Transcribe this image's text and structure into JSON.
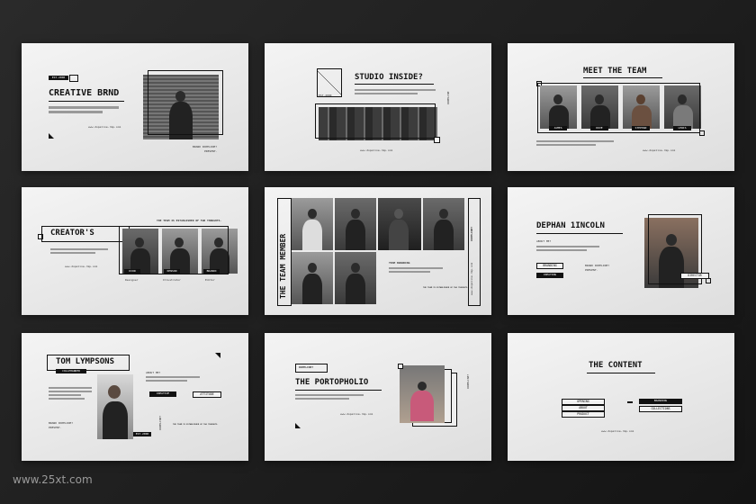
{
  "s1": {
    "badge": "EST.2000",
    "title": "CREATIVE BRND",
    "url": "www.dopeline-rmp.com",
    "footer1": "BRAND DOPELINE?",
    "footer2": "PRESENT."
  },
  "s2": {
    "title": "STUDIO INSIDE?",
    "label": "EST.2000",
    "side": "DOPELINE",
    "url": "www.dopeline-rmp.com"
  },
  "s3": {
    "title": "MEET THE TEAM",
    "names": [
      "JAMES",
      "DOVE",
      "STEPHAN",
      "LEWIS"
    ],
    "url": "www.dopeline-rmp.com"
  },
  "s4": {
    "title": "CREATOR'S",
    "note": "THE TEAM IS ESTABLISHED OF TWO THOUGHTS.",
    "names": [
      "DION",
      "KENSON",
      "BRANDO"
    ],
    "roles": [
      "Designer",
      "Illustrator",
      "Editor"
    ],
    "url": "www.dopeline-rmp.com"
  },
  "s5": {
    "vertical": "THE TEAM MEMBER",
    "side": "DOPELINE?",
    "label": "TEAM BRANDING",
    "note": "THE TEAM IS ESTABLISHED OF TWO THOUGHTS.",
    "url": "www.dopeline-rmp.com"
  },
  "s6": {
    "title": "DEPHAN 1INCOLN",
    "about": "ABOUT ME?",
    "b1": "BRANDING",
    "b2": "CREATING",
    "brand": "BRAND DOPELINE?",
    "present": "PRESENT.",
    "role": "DIRECTOR"
  },
  "s7": {
    "title": "TOM LYMPSONS",
    "sub": "COLLPHANDER",
    "about": "ABOUT ME?",
    "b1": "CREATIVE",
    "b2": "ATTITUDE",
    "brand": "BRAND DOPELINE?",
    "present": "PRESENT.",
    "est": "EST.2000",
    "note": "THE TEAM IS ESTABLISHED OF TWO THOUGHTS."
  },
  "s8": {
    "tag": "DOPELINE?",
    "title": "THE PORTOPHOLIO",
    "url": "www.dopeline-rmp.com"
  },
  "s9": {
    "title": "THE CONTENT",
    "left": [
      "OPENING",
      "ABOUT",
      "PRODUCT"
    ],
    "right": [
      "BRANDING",
      "COLLECTIONS"
    ],
    "url": "www.dopeline-rmp.com"
  },
  "watermark": "www.25xt.com"
}
